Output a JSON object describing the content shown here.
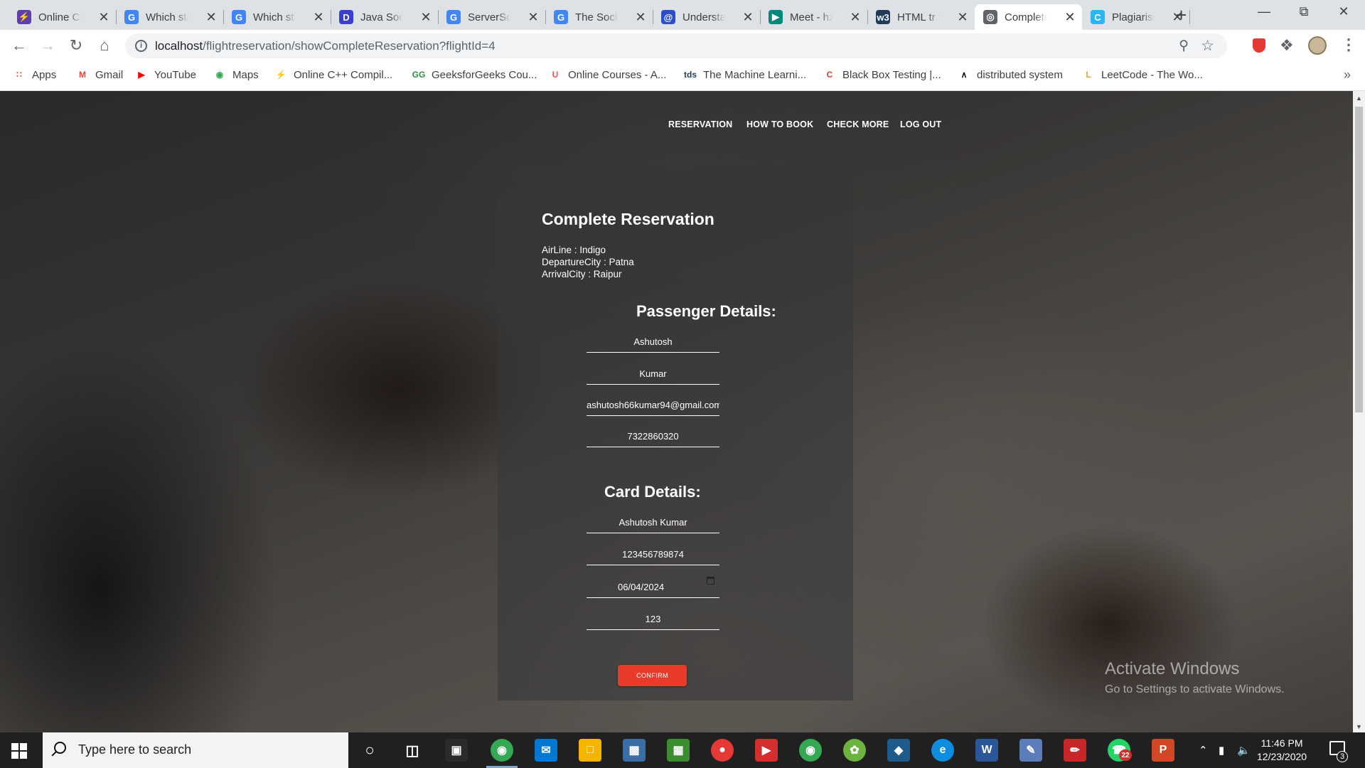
{
  "browser": {
    "tabs": [
      {
        "title": "Online C++",
        "favicon": "bolt",
        "color": "#5e3ea8"
      },
      {
        "title": "Which statement",
        "favicon": "G",
        "color": "#4285f4"
      },
      {
        "title": "Which statement",
        "favicon": "G",
        "color": "#4285f4"
      },
      {
        "title": "Java Socket",
        "favicon": "D",
        "color": "#3b3fcf"
      },
      {
        "title": "ServerSocket",
        "favicon": "G",
        "color": "#4285f4"
      },
      {
        "title": "The Socket",
        "favicon": "G",
        "color": "#4285f4"
      },
      {
        "title": "Understanding",
        "favicon": "spiral",
        "color": "#2d4ec9"
      },
      {
        "title": "Meet - hzj",
        "favicon": "meet",
        "color": "#00897b"
      },
      {
        "title": "HTML tr Tag",
        "favicon": "W3",
        "color": "#1f3a5a"
      },
      {
        "title": "Complete",
        "favicon": "globe",
        "color": "#5f6368",
        "active": true
      },
      {
        "title": "Plagiarism",
        "favicon": "C",
        "color": "#29b6f6"
      }
    ],
    "url_host": "localhost",
    "url_path": "/flightreservation/showCompleteReservation?flightId=4",
    "bookmarks": [
      {
        "label": "Apps",
        "icon": "apps-icon",
        "color": "#ea4335"
      },
      {
        "label": "Gmail",
        "icon": "gmail-icon",
        "color": "#ea4335"
      },
      {
        "label": "YouTube",
        "icon": "youtube-icon",
        "color": "#ff0000"
      },
      {
        "label": "Maps",
        "icon": "maps-icon",
        "color": "#34a853"
      },
      {
        "label": "Online C++ Compil...",
        "icon": "bolt-icon",
        "color": "#5e3ea8"
      },
      {
        "label": "GeeksforGeeks Cou...",
        "icon": "gfg-icon",
        "color": "#2f8d46"
      },
      {
        "label": "Online Courses - A...",
        "icon": "udemy-icon",
        "color": "#ec5252"
      },
      {
        "label": "The Machine Learni...",
        "icon": "tds-icon",
        "color": "#1f3a5a"
      },
      {
        "label": "Black Box Testing |...",
        "icon": "bbt-icon",
        "color": "#e53935"
      },
      {
        "label": "distributed system",
        "icon": "ds-icon",
        "color": "#111111"
      },
      {
        "label": "LeetCode - The Wo...",
        "icon": "leetcode-icon",
        "color": "#f89f1b"
      }
    ]
  },
  "site": {
    "nav": [
      "RESERVATION",
      "HOW TO BOOK",
      "CHECK MORE",
      "LOG OUT"
    ],
    "title": "Complete Reservation",
    "flight": {
      "airline": "AirLine : Indigo",
      "departure": "DepartureCity : Patna",
      "arrival": "ArrivalCity : Raipur"
    },
    "passenger_heading": "Passenger Details:",
    "passenger": {
      "first_name": "Ashutosh",
      "last_name": "Kumar",
      "email": "ashutosh66kumar94@gmail.com",
      "phone": "7322860320"
    },
    "card_heading": "Card Details:",
    "card": {
      "name": "Ashutosh Kumar",
      "number": "123456789874",
      "expiry": "06/04/2024",
      "cvv": "123"
    },
    "confirm_label": "CONFIRM"
  },
  "watermark": {
    "line1": "Activate Windows",
    "line2": "Go to Settings to activate Windows."
  },
  "taskbar": {
    "search_placeholder": "Type here to search",
    "time": "11:46 PM",
    "date": "12/23/2020",
    "whatsapp_badge": "22",
    "notification_count": "3"
  }
}
